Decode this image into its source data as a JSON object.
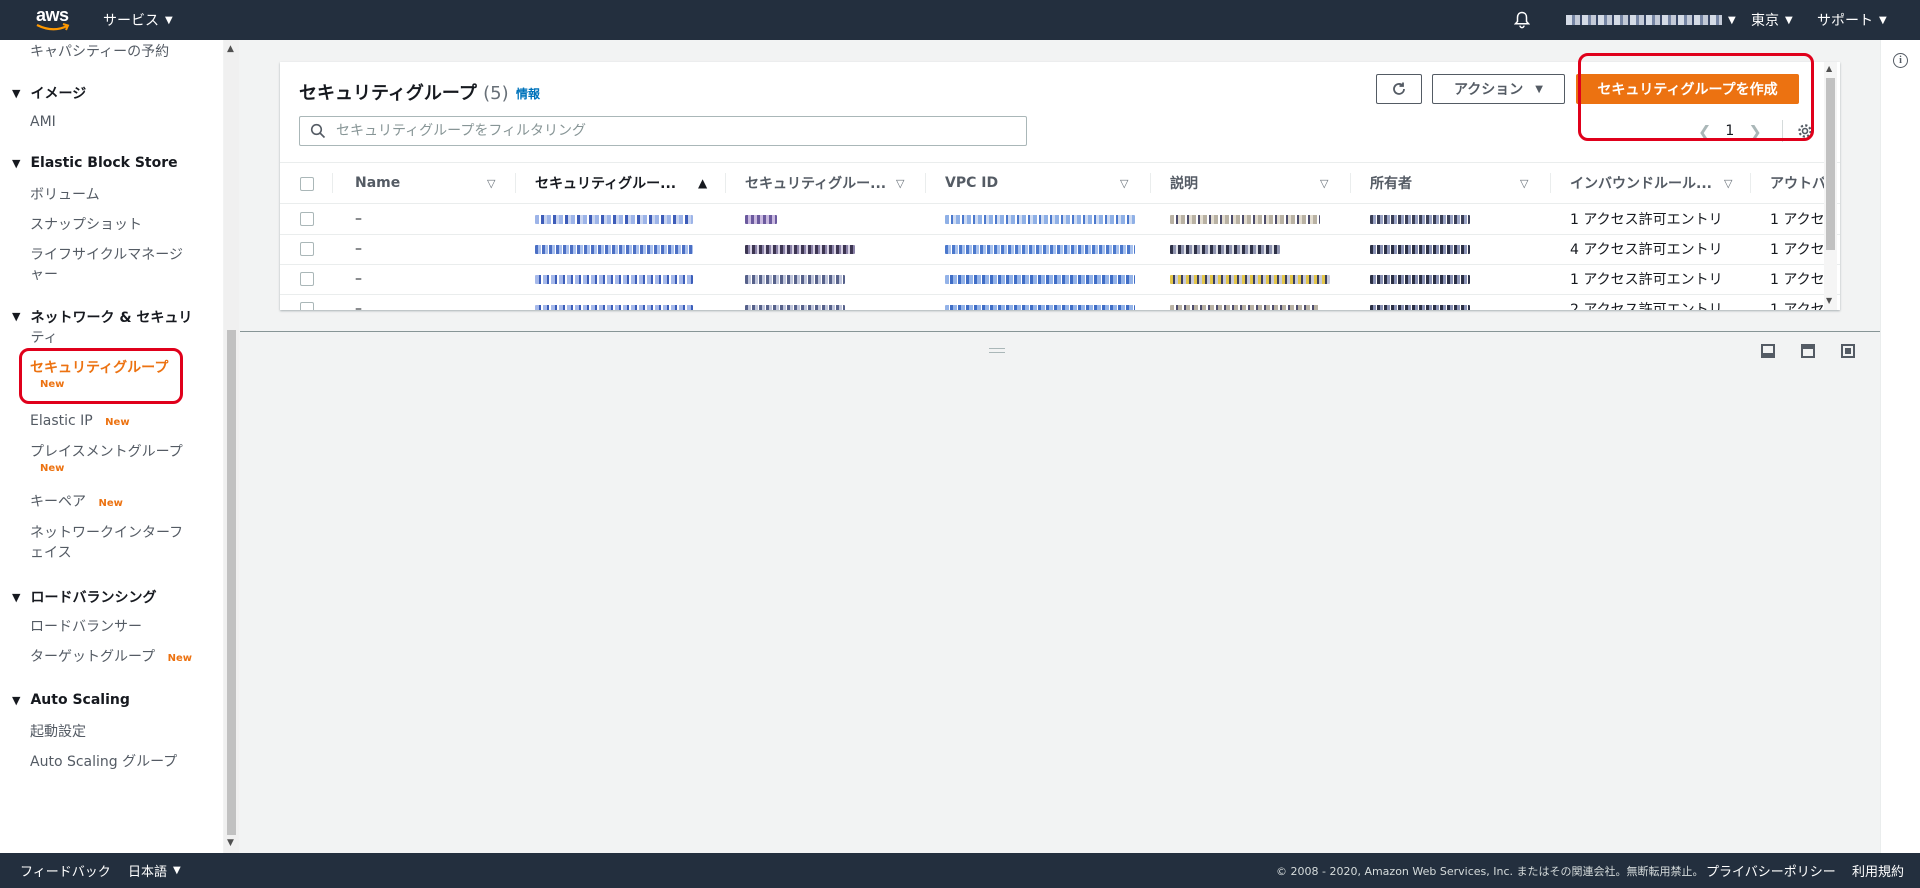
{
  "topbar": {
    "logo_text": "aws",
    "services_label": "サービス",
    "region_label": "東京",
    "support_label": "サポート"
  },
  "sidebar": {
    "capacity_reservation": "キャパシティーの予約",
    "images_header": "イメージ",
    "ami": "AMI",
    "ebs_header": "Elastic Block Store",
    "volumes": "ボリューム",
    "snapshots": "スナップショット",
    "lifecycle_manager_1": "ライフサイクルマネージ",
    "lifecycle_manager_2": "ャー",
    "network_header_1": "ネットワーク & セキュリ",
    "network_header_2": "ティ",
    "security_groups": "セキュリティグループ",
    "elastic_ip": "Elastic IP",
    "placement_groups": "プレイスメントグループ",
    "key_pairs": "キーペア",
    "network_interfaces_1": "ネットワークインターフ",
    "network_interfaces_2": "ェイス",
    "lb_header": "ロードバランシング",
    "load_balancers": "ロードバランサー",
    "target_groups": "ターゲットグループ",
    "asg_header": "Auto Scaling",
    "launch_configs": "起動設定",
    "asg_groups": "Auto Scaling グループ",
    "new_badge": "New"
  },
  "panel": {
    "title": "セキュリティグループ",
    "count": "(5)",
    "info": "情報",
    "actions_label": "アクション",
    "create_label": "セキュリティグループを作成",
    "search_placeholder": "セキュリティグループをフィルタリング",
    "page": "1"
  },
  "table": {
    "headers": [
      "Name",
      "セキュリティグルー...",
      "セキュリティグルー...",
      "VPC ID",
      "説明",
      "所有者",
      "インバウンドルール...",
      "アウトバ"
    ],
    "rows": [
      {
        "name": "–",
        "inbound": "1 アクセス許可エントリ",
        "outbound": "1 アクセ"
      },
      {
        "name": "–",
        "inbound": "4 アクセス許可エントリ",
        "outbound": "1 アクセ"
      },
      {
        "name": "–",
        "inbound": "1 アクセス許可エントリ",
        "outbound": "1 アクセ"
      },
      {
        "name": "–",
        "inbound": "2 アクセス許可エントリ",
        "outbound": "1 アクセ"
      }
    ]
  },
  "footer": {
    "feedback": "フィードバック",
    "language": "日本語",
    "copyright": "© 2008 - 2020, Amazon Web Services, Inc. またはその関連会社。無断転用禁止。",
    "privacy": "プライバシーポリシー",
    "terms": "利用規約"
  },
  "colors": {
    "accent": "#ec7211",
    "nav_bg": "#232f3e",
    "link": "#0073bb",
    "highlight": "#e0001b"
  }
}
